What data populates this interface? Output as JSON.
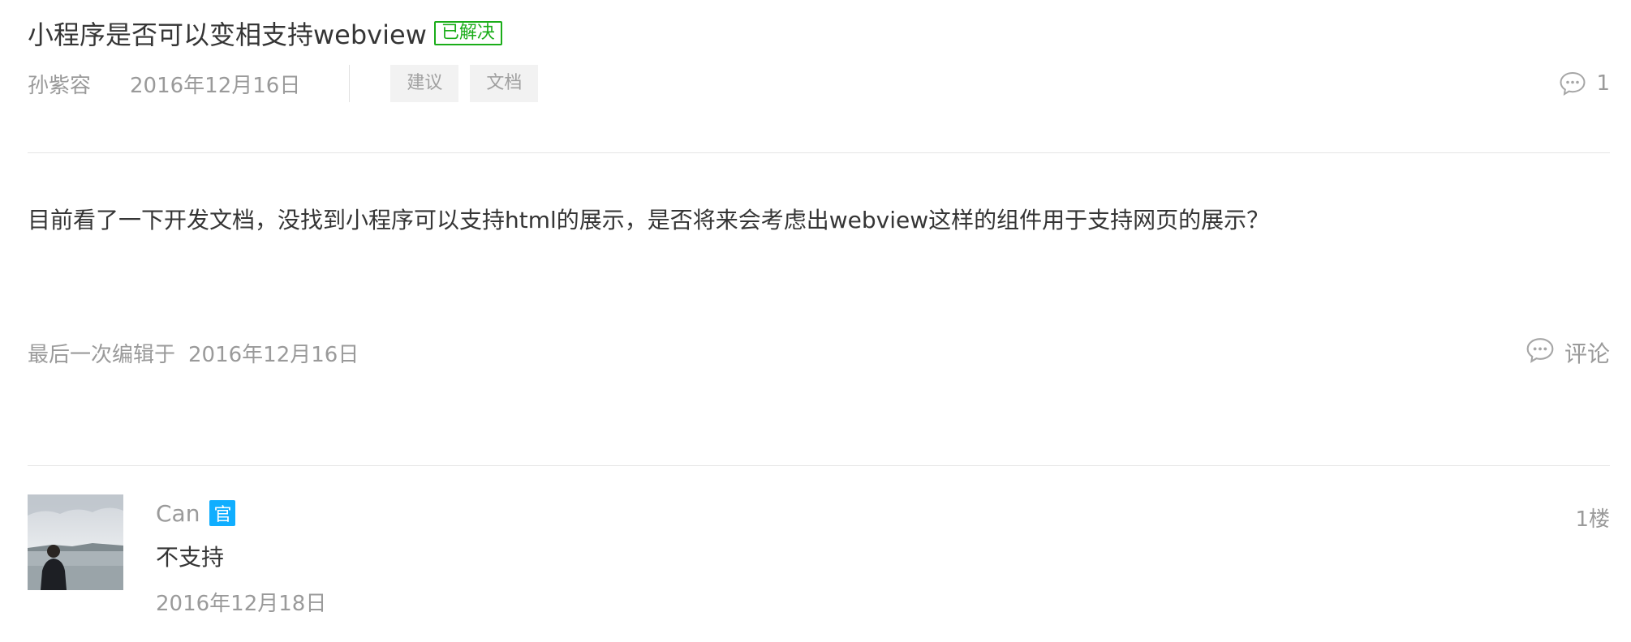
{
  "post": {
    "title": "小程序是否可以变相支持webview",
    "status_badge": "已解决",
    "author": "孙紫容",
    "date": "2016年12月16日",
    "tags": [
      "建议",
      "文档"
    ],
    "comment_count": "1",
    "content": "目前看了一下开发文档，没找到小程序可以支持html的展示，是否将来会考虑出webview这样的组件用于支持网页的展示？",
    "edit_label": "最后一次编辑于",
    "edit_date": "2016年12月16日",
    "comment_button_label": "评论"
  },
  "reply": {
    "author": "Can",
    "official_badge": "官",
    "text": "不支持",
    "date": "2016年12月18日",
    "floor": "1楼"
  },
  "colors": {
    "solved_green": "#1aad19",
    "official_blue": "#10aeff",
    "muted_text": "#9a9a9a",
    "body_text": "#353535"
  },
  "icons": {
    "comment_count": "comment-bubble-icon",
    "comment_button": "comment-bubble-icon"
  }
}
